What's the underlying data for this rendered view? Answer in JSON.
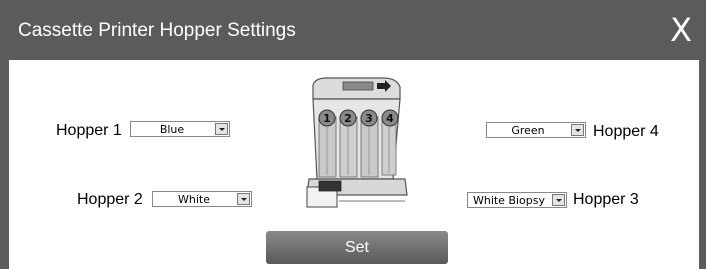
{
  "window": {
    "title": "Cassette Printer Hopper Settings",
    "close_label": "X"
  },
  "hoppers": [
    {
      "label": "Hopper 1",
      "value": "Blue"
    },
    {
      "label": "Hopper 2",
      "value": "White"
    },
    {
      "label": "Hopper 3",
      "value": "White Biopsy"
    },
    {
      "label": "Hopper 4",
      "value": "Green"
    }
  ],
  "printer_image": {
    "hopper_numbers": [
      "1",
      "2",
      "3",
      "4"
    ]
  },
  "actions": {
    "set_label": "Set"
  },
  "colors": {
    "titlebar": "#5b5b5b",
    "button": "#707070"
  }
}
